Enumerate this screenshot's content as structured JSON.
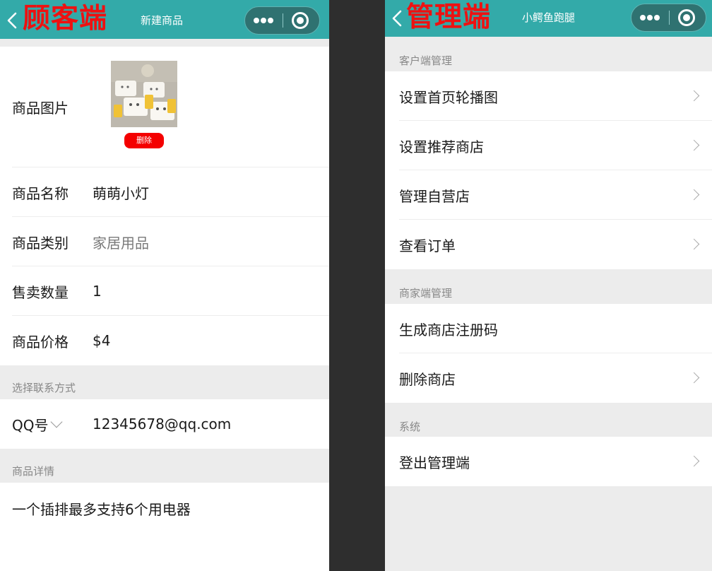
{
  "customer": {
    "role_label": "顾客端",
    "nav_title": "新建商品",
    "image_label": "商品图片",
    "delete_label": "删除",
    "fields": [
      {
        "label": "商品名称",
        "value": "萌萌小灯",
        "placeholder": false
      },
      {
        "label": "商品类别",
        "value": "家居用品",
        "placeholder": true
      },
      {
        "label": "售卖数量",
        "value": "1",
        "placeholder": false
      },
      {
        "label": "商品价格",
        "value": "$4",
        "placeholder": false
      }
    ],
    "contact_section": "选择联系方式",
    "contact_type": "QQ号",
    "contact_value": "12345678@qq.com",
    "detail_section": "商品详情",
    "detail_text": "一个插排最多支持6个用电器"
  },
  "admin": {
    "role_label": "管理端",
    "nav_title": "小鳄鱼跑腿",
    "groups": [
      {
        "title": "客户端管理",
        "items": [
          "设置首页轮播图",
          "设置推荐商店",
          "管理自营店",
          "查看订单"
        ]
      },
      {
        "title": "商家端管理",
        "items": [
          "生成商店注册码",
          "删除商店"
        ]
      },
      {
        "title": "系统",
        "items": [
          "登出管理端"
        ]
      }
    ]
  },
  "colors": {
    "navbar": "#33aaa9",
    "role_label": "#ee1111",
    "delete_button": "#f40000",
    "section_background": "#ececec"
  }
}
